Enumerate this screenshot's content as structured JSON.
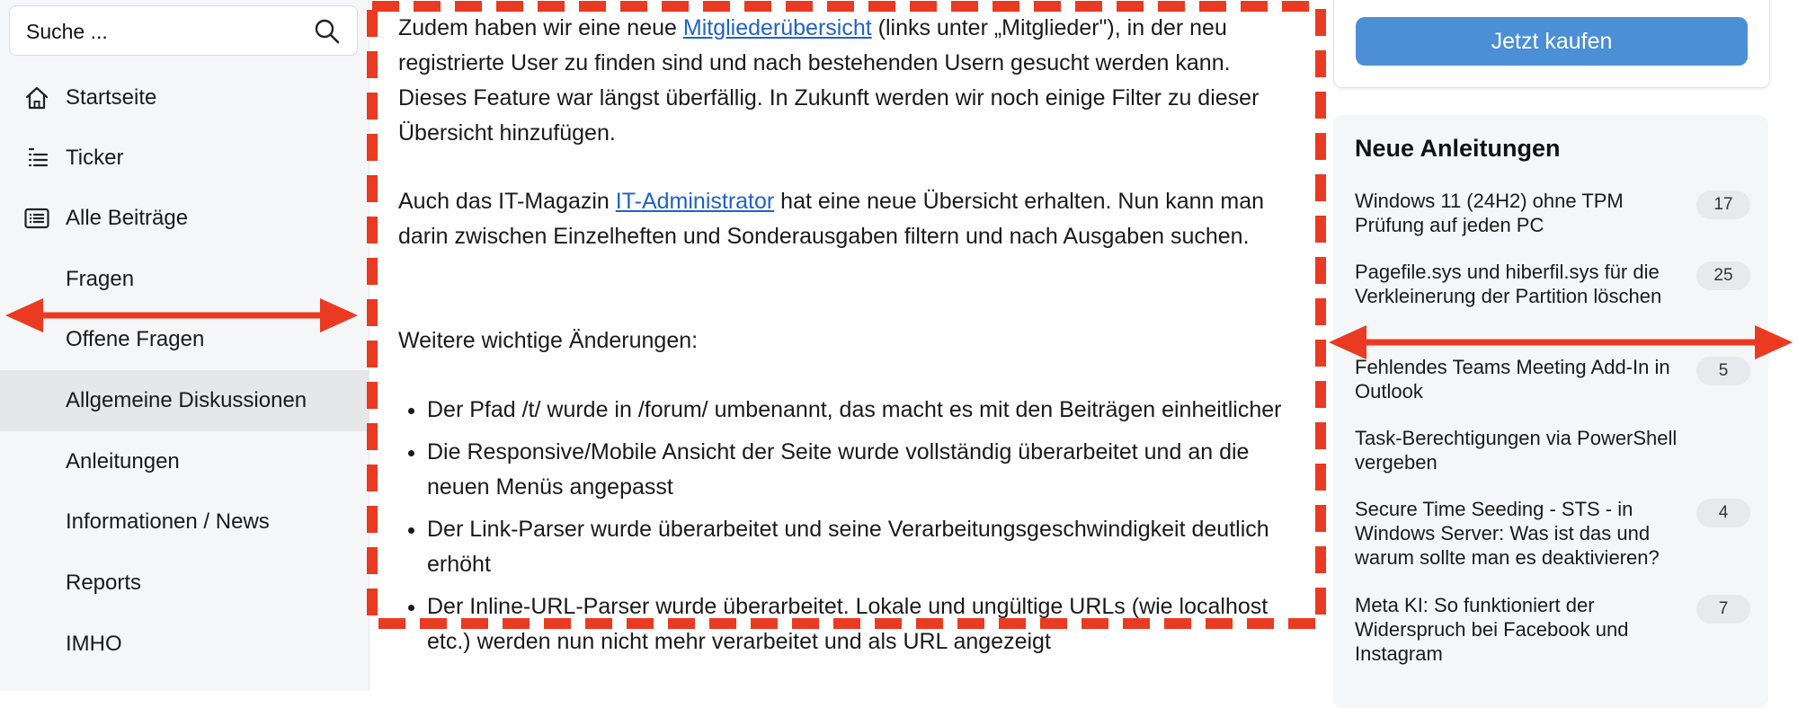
{
  "search": {
    "placeholder": "Suche ..."
  },
  "icons": {
    "search": "search-icon",
    "home": "home-icon",
    "ticker": "ticker-icon",
    "list": "list-icon"
  },
  "colors": {
    "accent": "#4b8fd6",
    "link": "#1f62c9",
    "annotation": "#ea3a22",
    "sidebar_bg": "#f5f6f7",
    "active_bg": "#e6e7e9"
  },
  "nav": [
    {
      "label": "Startseite",
      "icon": "home-icon"
    },
    {
      "label": "Ticker",
      "icon": "ticker-icon"
    },
    {
      "label": "Alle Beiträge",
      "icon": "list-icon"
    },
    {
      "label": "Fragen"
    },
    {
      "label": "Offene Fragen"
    },
    {
      "label": "Allgemeine Diskussionen",
      "active": true
    },
    {
      "label": "Anleitungen"
    },
    {
      "label": "Informationen / News"
    },
    {
      "label": "Reports"
    },
    {
      "label": "IMHO"
    }
  ],
  "article": {
    "p1_before": "Zudem haben wir eine neue ",
    "p1_link": "Mitgliederübersicht",
    "p1_after": " (links unter „Mitglieder\"), in der neu registrierte User zu finden sind und nach bestehenden Usern gesucht werden kann. Dieses Feature war längst überfällig. In Zukunft werden wir noch einige Filter zu dieser Übersicht hinzufügen.",
    "p2_before": "Auch das IT-Magazin ",
    "p2_link": "IT-Administrator",
    "p2_after": " hat eine neue Übersicht erhalten. Nun kann man darin zwischen Einzelheften und Sonderausgaben filtern und nach Ausgaben suchen.",
    "p3": "Weitere wichtige Änderungen:",
    "bullets": [
      "Der Pfad /t/ wurde in /forum/ umbenannt, das macht es mit den Beiträgen einheitlicher",
      "Die Responsive/Mobile Ansicht der Seite wurde vollständig überarbeitet und an die neuen Menüs angepasst",
      "Der Link-Parser wurde überarbeitet und seine Verarbeitungsgeschwindigkeit deutlich erhöht",
      "Der Inline-URL-Parser wurde überarbeitet. Lokale und ungültige URLs (wie localhost etc.) werden nun nicht mehr verarbeitet und als URL angezeigt"
    ]
  },
  "buy": {
    "label": "Jetzt kaufen"
  },
  "guides": {
    "title": "Neue Anleitungen",
    "items": [
      {
        "title": "Windows 11 (24H2) ohne TPM Prüfung auf jeden PC",
        "count": "17"
      },
      {
        "title": "Pagefile.sys und hiberfil.sys für die Verkleinerung der Partition löschen",
        "count": "25"
      },
      {
        "title": "Fehlendes Teams Meeting Add-In in Outlook",
        "count": "5"
      },
      {
        "title": "Task-Berechtigungen via PowerShell vergeben",
        "count": ""
      },
      {
        "title": "Secure Time Seeding - STS - in Windows Server: Was ist das und warum sollte man es deaktivieren?",
        "count": "4"
      },
      {
        "title": "Meta KI: So funktioniert der Widerspruch bei Facebook und Instagram",
        "count": "7"
      }
    ]
  }
}
